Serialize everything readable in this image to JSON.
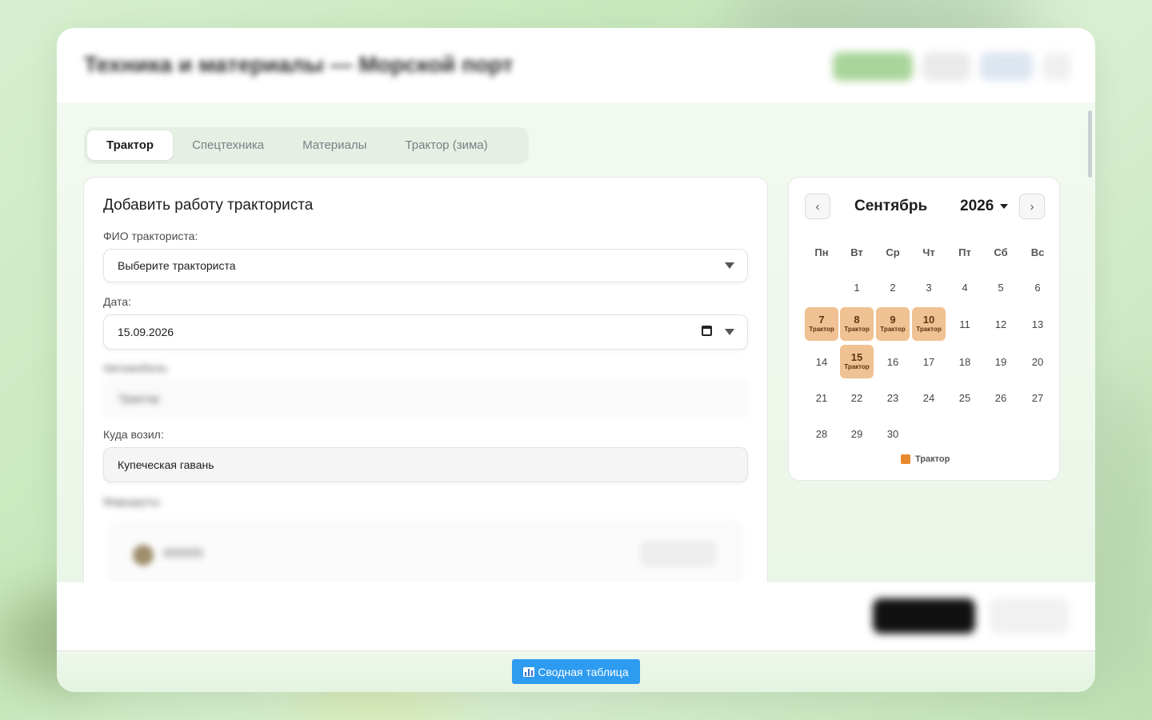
{
  "tabs": [
    {
      "label": "Трактор",
      "active": true
    },
    {
      "label": "Спецтехника",
      "active": false
    },
    {
      "label": "Материалы",
      "active": false
    },
    {
      "label": "Трактор (зима)",
      "active": false
    }
  ],
  "form": {
    "title": "Добавить работу тракториста",
    "driver_label": "ФИО тракториста:",
    "driver_value": "Выберите тракториста",
    "date_label": "Дата:",
    "date_value": "15.09.2026",
    "destination_label": "Куда возил:",
    "destination_value": "Купеческая гавань"
  },
  "calendar": {
    "prev_label": "‹",
    "next_label": "›",
    "month": "Сентябрь",
    "year": "2026",
    "weekdays": [
      "Пн",
      "Вт",
      "Ср",
      "Чт",
      "Пт",
      "Сб",
      "Вс"
    ],
    "first_weekday_index": 1,
    "days_in_month": 30,
    "marked_days": [
      7,
      8,
      9,
      10,
      15
    ],
    "marked_label": "Трактор",
    "legend_label": "Трактор",
    "legend_color": "#e8892e",
    "marked_color": "#f0c192"
  },
  "footer": {
    "summary_button": "Сводная таблица",
    "summary_icon": "bar-chart-icon"
  },
  "colors": {
    "accent_blue": "#2d9bf0",
    "body_bg": "#eaf6e7"
  }
}
